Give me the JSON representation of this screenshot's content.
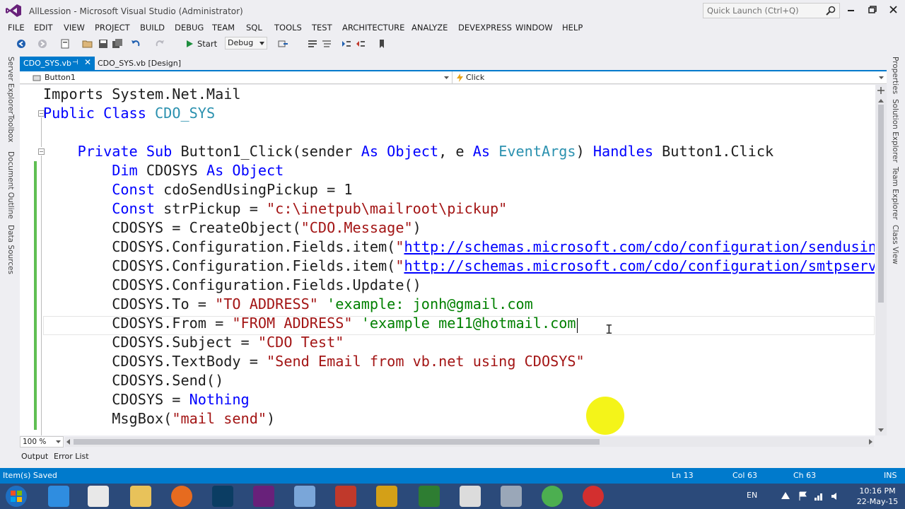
{
  "window": {
    "title": "AllLession - Microsoft Visual Studio (Administrator)",
    "quick_launch_placeholder": "Quick Launch (Ctrl+Q)"
  },
  "menu": [
    "FILE",
    "EDIT",
    "VIEW",
    "PROJECT",
    "BUILD",
    "DEBUG",
    "TEAM",
    "SQL",
    "TOOLS",
    "TEST",
    "ARCHITECTURE",
    "ANALYZE",
    "DEVEXPRESS",
    "WINDOW",
    "HELP"
  ],
  "toolbar": {
    "start_label": "Start",
    "config_value": "Debug"
  },
  "left_panels": [
    "Server Explorer",
    "Toolbox",
    "Document Outline",
    "Data Sources"
  ],
  "right_panels": [
    "Properties",
    "Solution Explorer",
    "Team Explorer",
    "Class View"
  ],
  "tabs": {
    "active": "CDO_SYS.vb",
    "active_pin": "⊣",
    "active_close": "✕",
    "second": "CDO_SYS.vb [Design]"
  },
  "navbar": {
    "object": "Button1",
    "member": "Click"
  },
  "code": {
    "l1": "Imports System.Net.Mail",
    "l2_kw": "Public Class",
    "l2_ty": "CDO_SYS",
    "l4_kw1": "Private Sub",
    "l4_a": "Button1_Click(sender",
    "l4_kw2": "As Object",
    "l4_b": ", e",
    "l4_kw3": "As",
    "l4_ty": "EventArgs",
    "l4_c": ")",
    "l4_kw4": "Handles",
    "l4_d": "Button1.Click",
    "l5_kw1": "Dim",
    "l5_a": "CDOSYS",
    "l5_kw2": "As Object",
    "l6_kw": "Const",
    "l6_a": "cdoSendUsingPickup = 1",
    "l7_kw": "Const",
    "l7_a": "strPickup =",
    "l7_st": "\"c:\\inetpub\\mailroot\\pickup\"",
    "l8_a": "CDOSYS = CreateObject(",
    "l8_st": "\"CDO.Message\"",
    "l8_b": ")",
    "l9_a": "CDOSYS.Configuration.Fields.item(",
    "l9_q": "\"",
    "l9_link": "http://schemas.microsoft.com/cdo/configuration/sendusin",
    "l10_a": "CDOSYS.Configuration.Fields.item(",
    "l10_q": "\"",
    "l10_link": "http://schemas.microsoft.com/cdo/configuration/smtpserv",
    "l11": "CDOSYS.Configuration.Fields.Update()",
    "l12_a": "CDOSYS.To =",
    "l12_st": "\"TO ADDRESS\"",
    "l12_cm": "'example: jonh@gmail.com",
    "l13_a": "CDOSYS.From =",
    "l13_st": "\"FROM ADDRESS\"",
    "l13_cm": "'example me11@hotmail.com",
    "l14_a": "CDOSYS.Subject =",
    "l14_st": "\"CDO Test\"",
    "l15_a": "CDOSYS.TextBody =",
    "l15_st": "\"Send Email from vb.net using CDOSYS\"",
    "l16": "CDOSYS.Send()",
    "l17_a": "CDOSYS =",
    "l17_kw": "Nothing",
    "l18_a": "MsgBox(",
    "l18_st": "\"mail send\"",
    "l18_b": ")"
  },
  "zoom": "100 %",
  "bottom_tabs": [
    "Output",
    "Error List"
  ],
  "status": {
    "message": "Item(s) Saved",
    "line": "Ln 13",
    "col": "Col 63",
    "ch": "Ch 63",
    "mode": "INS"
  },
  "taskbar": {
    "lang": "EN",
    "time": "10:16 PM",
    "date": "22-May-15"
  },
  "colors": {
    "accent": "#007acc",
    "keyword": "#0000ff",
    "type": "#2b91af",
    "string": "#a31515",
    "comment": "#008000",
    "change_mark": "#5fbf53",
    "cursor_highlight": "#f3f300"
  }
}
